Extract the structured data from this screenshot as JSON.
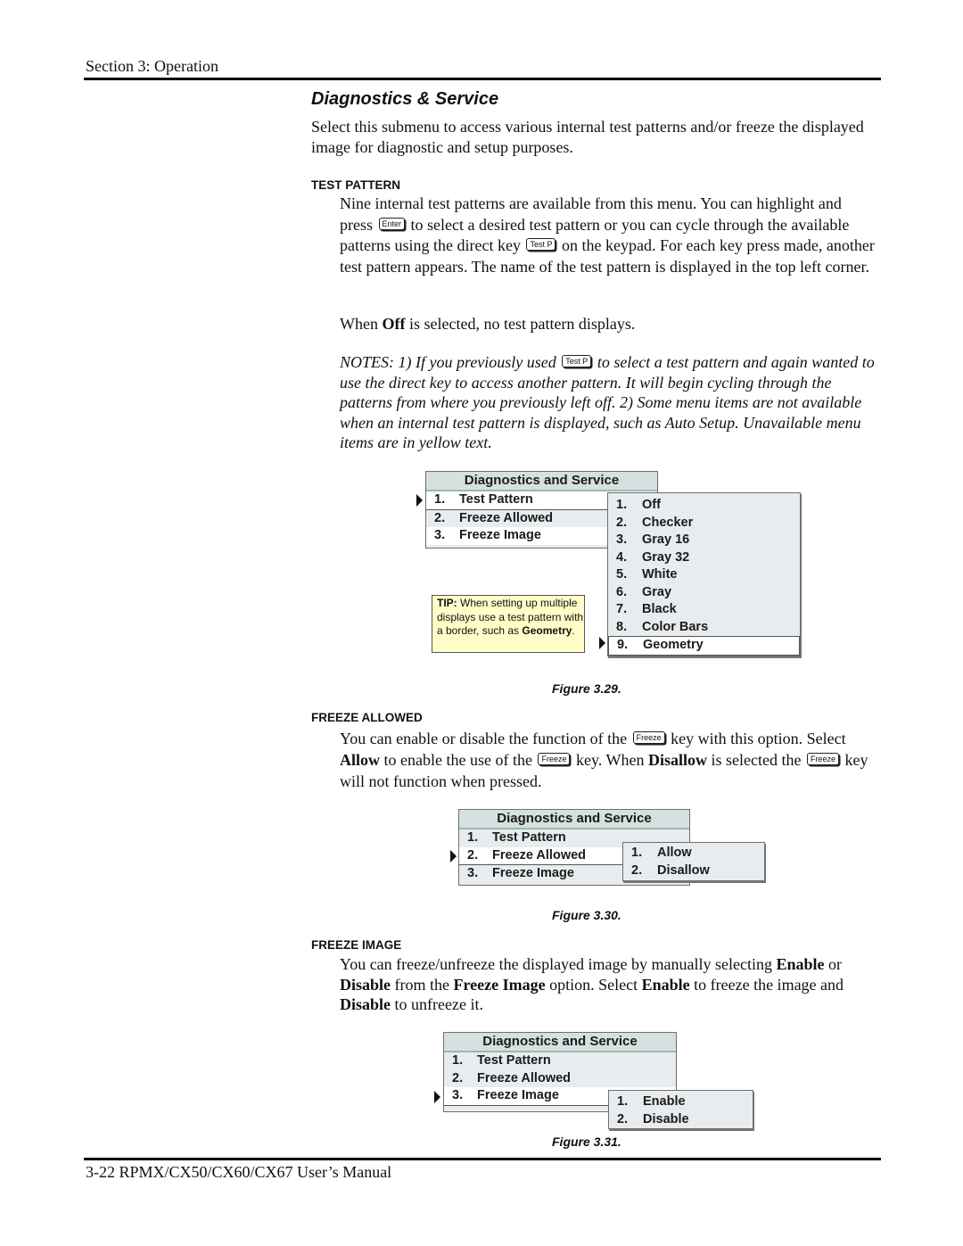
{
  "header": {
    "section": "Section 3: Operation"
  },
  "footer": {
    "text": "3-22 RPMX/CX50/CX60/CX67 User’s Manual"
  },
  "title": "Diagnostics & Service",
  "intro": "Select this submenu to access various internal test patterns and/or freeze the displayed image for diagnostic and setup purposes.",
  "keys": {
    "enter": "Enter",
    "test_p": "Test P",
    "freeze": "Freeze"
  },
  "test_pattern": {
    "heading": "TEST PATTERN",
    "p1_a": "Nine internal test patterns are available from this menu. You can highlight and press ",
    "p1_b": " to select a desired test pattern or you can cycle through the available patterns using the direct key ",
    "p1_c": " on the keypad. For each key press made, another test pattern appears. The name of the test pattern is displayed in the top left corner.",
    "off_a": "When ",
    "off_b": "Off",
    "off_c": " is selected, no test pattern displays.",
    "notes_a": "NOTES: 1) If you previously used ",
    "notes_b": " to select a test pattern and again wanted to use the direct key to access another pattern. It will begin cycling through the patterns from where you previously left off. 2) Some menu items are not available when an internal test pattern is displayed, such as Auto Setup. Unavailable menu items are in yellow text."
  },
  "menu": {
    "title": "Diagnostics and Service",
    "items": [
      {
        "num": "1.",
        "label": "Test Pattern"
      },
      {
        "num": "2.",
        "label": "Freeze Allowed"
      },
      {
        "num": "3.",
        "label": "Freeze Image"
      }
    ]
  },
  "figure_29": {
    "caption": "Figure 3.29.",
    "selected_menu_index": 0,
    "submenu": [
      {
        "num": "1.",
        "label": "Off"
      },
      {
        "num": "2.",
        "label": "Checker"
      },
      {
        "num": "3.",
        "label": "Gray 16"
      },
      {
        "num": "4.",
        "label": "Gray 32"
      },
      {
        "num": "5.",
        "label": "White"
      },
      {
        "num": "6.",
        "label": "Gray"
      },
      {
        "num": "7.",
        "label": "Black"
      },
      {
        "num": "8.",
        "label": "Color Bars"
      },
      {
        "num": "9.",
        "label": "Geometry"
      }
    ],
    "selected_submenu_index": 8,
    "tip": {
      "label": "TIP:",
      "text_a": " When setting up multiple displays use a test pattern with a border, such as ",
      "bold": "Geometry",
      "text_b": "."
    }
  },
  "freeze_allowed": {
    "heading": "FREEZE ALLOWED",
    "a": "You can enable or disable the function of the ",
    "b": " key with this option. Select ",
    "c": "Allow",
    "d": " to enable the use of the ",
    "e": " key. When ",
    "f": "Disallow",
    "g": " is selected the ",
    "h": " key will not function when pressed."
  },
  "figure_30": {
    "caption": "Figure 3.30.",
    "selected_menu_index": 1,
    "submenu": [
      {
        "num": "1.",
        "label": "Allow"
      },
      {
        "num": "2.",
        "label": "Disallow"
      }
    ]
  },
  "freeze_image": {
    "heading": "FREEZE IMAGE",
    "a": "You can freeze/unfreeze the displayed image by manually selecting ",
    "b": "Enable",
    "c": " or ",
    "d": "Disable",
    "e": " from the ",
    "f": "Freeze Image",
    "g": " option. Select ",
    "h": "Enable",
    "i": " to freeze the image and ",
    "j": "Disable",
    "k": " to unfreeze it."
  },
  "figure_31": {
    "caption": "Figure 3.31.",
    "selected_menu_index": 2,
    "submenu": [
      {
        "num": "1.",
        "label": "Enable"
      },
      {
        "num": "2.",
        "label": "Disable"
      }
    ]
  },
  "colors": {
    "menu_bg": "#e8ecee",
    "menu_title_bg": "#d6e0df",
    "tip_bg": "#fffdc8"
  }
}
